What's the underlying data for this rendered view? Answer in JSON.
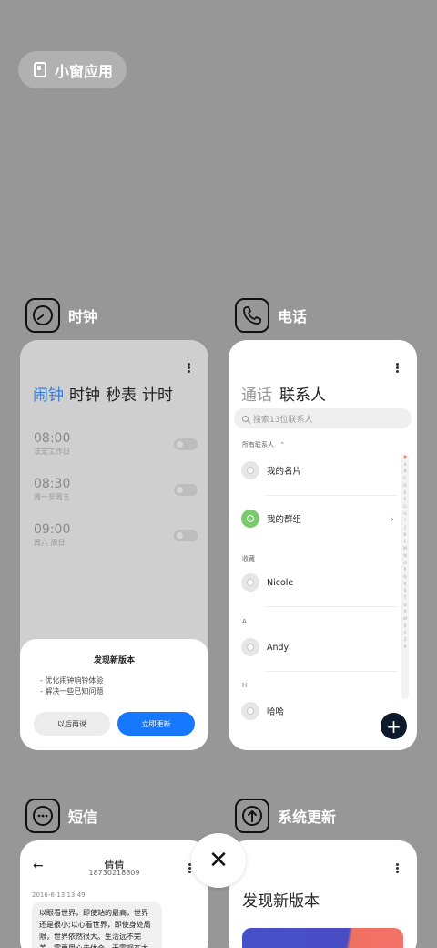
{
  "mini_window": {
    "label": "小窗应用"
  },
  "apps": {
    "clock": {
      "name": "时钟",
      "tabs": [
        "闹钟",
        "时钟",
        "秒表",
        "计时"
      ],
      "alarms": [
        {
          "time": "08:00",
          "repeat": "法定工作日",
          "enabled": false
        },
        {
          "time": "08:30",
          "repeat": "周一至周五",
          "enabled": false
        },
        {
          "time": "09:00",
          "repeat": "周六 周日",
          "enabled": false
        }
      ],
      "update_dialog": {
        "title": "发现新版本",
        "notes": [
          "- 优化闹钟响铃体验",
          "- 解决一些已知问题"
        ],
        "later_button": "以后再说",
        "update_button": "立即更新"
      }
    },
    "phone": {
      "name": "电话",
      "tabs": [
        "通话",
        "联系人"
      ],
      "search_placeholder": "搜索13位联系人",
      "all_contacts_label": "所有联系人",
      "my_card": "我的名片",
      "my_groups": "我的群组",
      "favorites_label": "收藏",
      "contacts": [
        {
          "section": "",
          "name": "Nicole"
        },
        {
          "section": "A",
          "name": "Andy"
        },
        {
          "section": "H",
          "name": "哈哈"
        }
      ],
      "index_letters": [
        "♥",
        "A",
        "B",
        "C",
        "D",
        "E",
        "F",
        "G",
        "H",
        "I",
        "J",
        "K",
        "L",
        "M",
        "N",
        "O",
        "P",
        "Q",
        "R",
        "S",
        "T",
        "U",
        "V",
        "W",
        "X",
        "Y",
        "Z",
        "#"
      ],
      "add_button": "+"
    },
    "messages": {
      "name": "短信",
      "contact_name": "倩倩",
      "contact_number": "18730218809",
      "date": "2016-6-13 13:49",
      "message": "以眼看世界，即使站的最高，世界还是很小;以心看世界，即使身处局限，世界依然很大。生活远不完美，需要用心去体会，无需观在太"
    },
    "system_update": {
      "name": "系统更新",
      "title": "发现新版本"
    }
  },
  "close_button": "✕",
  "colors": {
    "background": "#979797",
    "accent_blue": "#1677ff",
    "tab_active_blue": "#3a7bd5",
    "fab_dark": "#0e1a2b",
    "group_green": "#7bc96f"
  }
}
